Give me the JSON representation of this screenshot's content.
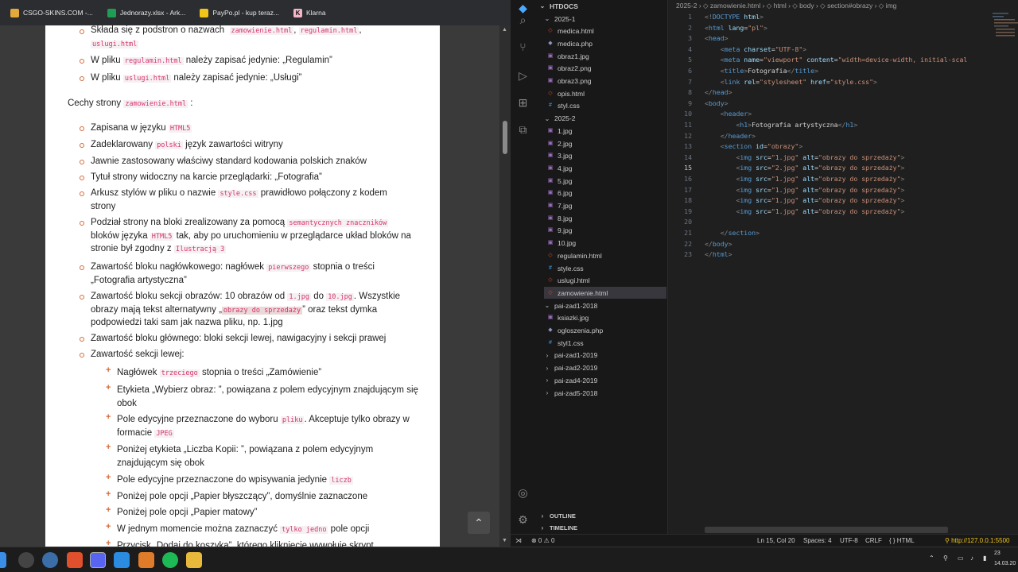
{
  "bookmarks": [
    {
      "label": "CSGO-SKINS.COM -...",
      "color": "#e2a93b"
    },
    {
      "label": "Jednorazy.xlsx - Ark...",
      "color": "#1f9d55"
    },
    {
      "label": "PayPo.pl - kup teraz...",
      "color": "#f0c419"
    },
    {
      "label": "Klarna",
      "color": "#f4b6c7"
    }
  ],
  "doc": {
    "l1_a": "Składa się z podstron o nazwach",
    "l1_c1": "zamowienie.html",
    "l1_sep1": ",",
    "l1_c2": "regulamin.html",
    "l1_sep2": ",",
    "l1_c3": "uslugi.html",
    "l2_a": "W pliku",
    "l2_c": "regulamin.html",
    "l2_b": "należy zapisać jedynie: „Regulamin”",
    "l3_a": "W pliku",
    "l3_c": "uslugi.html",
    "l3_b": "należy zapisać jedynie: „Usługi”",
    "cechy_a": "Cechy strony",
    "cechy_c": "zamowienie.html",
    "cechy_b": ":",
    "b1_a": "Zapisana w języku",
    "b1_c": "HTML5",
    "b2_a": "Zadeklarowany",
    "b2_c": "polski",
    "b2_b": "język zawartości witryny",
    "b3": "Jawnie zastosowany właściwy standard kodowania polskich znaków",
    "b4": "Tytuł strony widoczny na karcie przeglądarki: „Fotografia”",
    "b5_a": "Arkusz stylów w pliku o nazwie",
    "b5_c": "style.css",
    "b5_b": "prawidłowo połączony z kodem",
    "b5_d": "strony",
    "b6_a": "Podział strony na bloki zrealizowany za pomocą",
    "b6_c": "semantycznych znaczników",
    "b6_b": "bloków języka",
    "b6_c2": "HTML5",
    "b6_d": "tak, aby po uruchomieniu w przeglądarce układ bloków na",
    "b6_e": "stronie był zgodny z",
    "b6_c3": "Ilustracją 3",
    "b7_a": "Zawartość bloku nagłówkowego: nagłówek",
    "b7_c": "pierwszego",
    "b7_b": "stopnia o treści",
    "b7_d": "„Fotografia artystyczna”",
    "b8_a": "Zawartość bloku sekcji obrazów: 10 obrazów od",
    "b8_c1": "1.jpg",
    "b8_m": "do",
    "b8_c2": "10.jpg",
    "b8_b": ". Wszystkie",
    "b8_d": "obrazy mają tekst alternatywny „",
    "b8_c3": "obrazy do sprzedaży",
    "b8_e": "” oraz tekst dymka",
    "b8_f": "podpowiedzi taki sam jak nazwa pliku, np. 1.jpg",
    "b9": "Zawartość bloku głównego: bloki sekcji lewej, nawigacyjny i sekcji prawej",
    "b10": "Zawartość sekcji lewej:",
    "s1_a": "Nagłówek",
    "s1_c": "trzeciego",
    "s1_b": "stopnia o treści „Zamówienie”",
    "s2_a": "Etykieta „Wybierz obraz: ”, powiązana z polem edycyjnym znajdującym się",
    "s2_b": "obok",
    "s3_a": "Pole edycyjne przeznaczone do wyboru",
    "s3_c": "pliku",
    "s3_b": ". Akceptuje tylko obrazy w",
    "s3_d": "formacie",
    "s3_c2": "JPEG",
    "s4_a": "Poniżej etykieta „Liczba Kopii: ”, powiązana z polem edycyjnym",
    "s4_b": "znajdującym się obok",
    "s5_a": "Pole edycyjne przeznaczone do wpisywania jedynie",
    "s5_c": "liczb",
    "s6": "Poniżej pole opcji „Papier błyszczący”, domyślnie zaznaczone",
    "s7": "Poniżej pole opcji „Papier matowy”",
    "s8_a": "W jednym momencie można zaznaczyć",
    "s8_c": "tylko jedno",
    "s8_b": "pole opcji",
    "s9": "Przycisk „Dodaj do koszyka”, którego kliknięcie wywołuje skrypt"
  },
  "explorer": {
    "root": "HTDOCS",
    "items": [
      {
        "label": "2025-1",
        "kind": "folder-open"
      },
      {
        "label": "medica.html",
        "kind": "html"
      },
      {
        "label": "medica.php",
        "kind": "php"
      },
      {
        "label": "obraz1.jpg",
        "kind": "img"
      },
      {
        "label": "obraz2.png",
        "kind": "img"
      },
      {
        "label": "obraz3.png",
        "kind": "img"
      },
      {
        "label": "opis.html",
        "kind": "html"
      },
      {
        "label": "styl.css",
        "kind": "css"
      },
      {
        "label": "2025-2",
        "kind": "folder-open"
      },
      {
        "label": "1.jpg",
        "kind": "img"
      },
      {
        "label": "2.jpg",
        "kind": "img"
      },
      {
        "label": "3.jpg",
        "kind": "img"
      },
      {
        "label": "4.jpg",
        "kind": "img"
      },
      {
        "label": "5.jpg",
        "kind": "img"
      },
      {
        "label": "6.jpg",
        "kind": "img"
      },
      {
        "label": "7.jpg",
        "kind": "img"
      },
      {
        "label": "8.jpg",
        "kind": "img"
      },
      {
        "label": "9.jpg",
        "kind": "img"
      },
      {
        "label": "10.jpg",
        "kind": "img"
      },
      {
        "label": "regulamin.html",
        "kind": "html"
      },
      {
        "label": "style.css",
        "kind": "css"
      },
      {
        "label": "uslugi.html",
        "kind": "html"
      },
      {
        "label": "zamowienie.html",
        "kind": "html",
        "selected": true
      },
      {
        "label": "pai-zad1-2018",
        "kind": "folder-open"
      },
      {
        "label": "ksiazki.jpg",
        "kind": "img"
      },
      {
        "label": "ogloszenia.php",
        "kind": "php"
      },
      {
        "label": "styl1.css",
        "kind": "css"
      },
      {
        "label": "pai-zad1-2019",
        "kind": "folder"
      },
      {
        "label": "pai-zad2-2019",
        "kind": "folder"
      },
      {
        "label": "pai-zad4-2019",
        "kind": "folder"
      },
      {
        "label": "pai-zad5-2018",
        "kind": "folder"
      }
    ],
    "outline": "OUTLINE",
    "timeline": "TIMELINE"
  },
  "editor": {
    "breadcrumb": "2025-2 › ◇ zamowienie.html › ◇ html › ◇ body › ◇ section#obrazy › ◇ img",
    "line_numbers": [
      "1",
      "2",
      "3",
      "4",
      "5",
      "6",
      "7",
      "8",
      "9",
      "10",
      "11",
      "12",
      "13",
      "14",
      "15",
      "16",
      "17",
      "18",
      "19",
      "20",
      "21",
      "22",
      "23"
    ],
    "current_line": 15,
    "lines": [
      [
        [
          "p",
          "<!"
        ],
        [
          "t",
          "DOCTYPE"
        ],
        [
          "a",
          " html"
        ],
        [
          "p",
          ">"
        ]
      ],
      [
        [
          "p",
          "<"
        ],
        [
          "t",
          "html"
        ],
        [
          "a",
          " lang"
        ],
        [
          "tx",
          "="
        ],
        [
          "s",
          "\"pl\""
        ],
        [
          "p",
          ">"
        ]
      ],
      [
        [
          "p",
          "<"
        ],
        [
          "t",
          "head"
        ],
        [
          "p",
          ">"
        ]
      ],
      [
        [
          "tx",
          "    "
        ],
        [
          "p",
          "<"
        ],
        [
          "t",
          "meta"
        ],
        [
          "a",
          " charset"
        ],
        [
          "tx",
          "="
        ],
        [
          "s",
          "\"UTF-8\""
        ],
        [
          "p",
          ">"
        ]
      ],
      [
        [
          "tx",
          "    "
        ],
        [
          "p",
          "<"
        ],
        [
          "t",
          "meta"
        ],
        [
          "a",
          " name"
        ],
        [
          "tx",
          "="
        ],
        [
          "s",
          "\"viewport\""
        ],
        [
          "a",
          " content"
        ],
        [
          "tx",
          "="
        ],
        [
          "s",
          "\"width=device-width, initial-scal"
        ]
      ],
      [
        [
          "tx",
          "    "
        ],
        [
          "p",
          "<"
        ],
        [
          "t",
          "title"
        ],
        [
          "p",
          ">"
        ],
        [
          "tx",
          "Fotografia"
        ],
        [
          "p",
          "</"
        ],
        [
          "t",
          "title"
        ],
        [
          "p",
          ">"
        ]
      ],
      [
        [
          "tx",
          "    "
        ],
        [
          "p",
          "<"
        ],
        [
          "t",
          "link"
        ],
        [
          "a",
          " rel"
        ],
        [
          "tx",
          "="
        ],
        [
          "s",
          "\"stylesheet\""
        ],
        [
          "a",
          " href"
        ],
        [
          "tx",
          "="
        ],
        [
          "s",
          "\"style.css\""
        ],
        [
          "p",
          ">"
        ]
      ],
      [
        [
          "p",
          "</"
        ],
        [
          "t",
          "head"
        ],
        [
          "p",
          ">"
        ]
      ],
      [
        [
          "p",
          "<"
        ],
        [
          "t",
          "body"
        ],
        [
          "p",
          ">"
        ]
      ],
      [
        [
          "tx",
          "    "
        ],
        [
          "p",
          "<"
        ],
        [
          "t",
          "header"
        ],
        [
          "p",
          ">"
        ]
      ],
      [
        [
          "tx",
          "        "
        ],
        [
          "p",
          "<"
        ],
        [
          "t",
          "h1"
        ],
        [
          "p",
          ">"
        ],
        [
          "tx",
          "Fotografia artystyczna"
        ],
        [
          "p",
          "</"
        ],
        [
          "t",
          "h1"
        ],
        [
          "p",
          ">"
        ]
      ],
      [
        [
          "tx",
          "    "
        ],
        [
          "p",
          "</"
        ],
        [
          "t",
          "header"
        ],
        [
          "p",
          ">"
        ]
      ],
      [
        [
          "tx",
          "    "
        ],
        [
          "p",
          "<"
        ],
        [
          "t",
          "section"
        ],
        [
          "a",
          " id"
        ],
        [
          "tx",
          "="
        ],
        [
          "s",
          "\"obrazy\""
        ],
        [
          "p",
          ">"
        ]
      ],
      [
        [
          "tx",
          "        "
        ],
        [
          "p",
          "<"
        ],
        [
          "t",
          "img"
        ],
        [
          "a",
          " src"
        ],
        [
          "tx",
          "="
        ],
        [
          "s",
          "\"1.jpg\""
        ],
        [
          "a",
          " alt"
        ],
        [
          "tx",
          "="
        ],
        [
          "s",
          "\"obrazy do sprzedaży\""
        ],
        [
          "p",
          ">"
        ]
      ],
      [
        [
          "tx",
          "        "
        ],
        [
          "p",
          "<"
        ],
        [
          "t",
          "img"
        ],
        [
          "a",
          " src"
        ],
        [
          "tx",
          "="
        ],
        [
          "s",
          "\"2.jpg\""
        ],
        [
          "a",
          " alt"
        ],
        [
          "tx",
          "="
        ],
        [
          "s",
          "\"obrazy do sprzedaży\""
        ],
        [
          "p",
          ">"
        ]
      ],
      [
        [
          "tx",
          "        "
        ],
        [
          "p",
          "<"
        ],
        [
          "t",
          "img"
        ],
        [
          "a",
          " src"
        ],
        [
          "tx",
          "="
        ],
        [
          "s",
          "\"1.jpg\""
        ],
        [
          "a",
          " alt"
        ],
        [
          "tx",
          "="
        ],
        [
          "s",
          "\"obrazy do sprzedaży\""
        ],
        [
          "p",
          ">"
        ]
      ],
      [
        [
          "tx",
          "        "
        ],
        [
          "p",
          "<"
        ],
        [
          "t",
          "img"
        ],
        [
          "a",
          " src"
        ],
        [
          "tx",
          "="
        ],
        [
          "s",
          "\"1.jpg\""
        ],
        [
          "a",
          " alt"
        ],
        [
          "tx",
          "="
        ],
        [
          "s",
          "\"obrazy do sprzedaży\""
        ],
        [
          "p",
          ">"
        ]
      ],
      [
        [
          "tx",
          "        "
        ],
        [
          "p",
          "<"
        ],
        [
          "t",
          "img"
        ],
        [
          "a",
          " src"
        ],
        [
          "tx",
          "="
        ],
        [
          "s",
          "\"1.jpg\""
        ],
        [
          "a",
          " alt"
        ],
        [
          "tx",
          "="
        ],
        [
          "s",
          "\"obrazy do sprzedaży\""
        ],
        [
          "p",
          ">"
        ]
      ],
      [
        [
          "tx",
          "        "
        ],
        [
          "p",
          "<"
        ],
        [
          "t",
          "img"
        ],
        [
          "a",
          " src"
        ],
        [
          "tx",
          "="
        ],
        [
          "s",
          "\"1.jpg\""
        ],
        [
          "a",
          " alt"
        ],
        [
          "tx",
          "="
        ],
        [
          "s",
          "\"obrazy do sprzedaży\""
        ],
        [
          "p",
          ">"
        ]
      ],
      [
        [
          "tx",
          ""
        ]
      ],
      [
        [
          "tx",
          "    "
        ],
        [
          "p",
          "</"
        ],
        [
          "t",
          "section"
        ],
        [
          "p",
          ">"
        ]
      ],
      [
        [
          "p",
          "</"
        ],
        [
          "t",
          "body"
        ],
        [
          "p",
          ">"
        ]
      ],
      [
        [
          "p",
          "</"
        ],
        [
          "t",
          "html"
        ],
        [
          "p",
          ">"
        ]
      ]
    ]
  },
  "status": {
    "problems": "⊗ 0 ⚠ 0",
    "cursor": "Ln 15, Col 20",
    "spaces": "Spaces: 4",
    "encoding": "UTF-8",
    "eol": "CRLF",
    "lang": "{ } HTML",
    "server": "⚲ http://127.0.0.1:5500",
    "time": "23",
    "date": "14.03.20"
  },
  "colors": {
    "accent": "#d26a3a",
    "code_pink": "#d6336c"
  }
}
